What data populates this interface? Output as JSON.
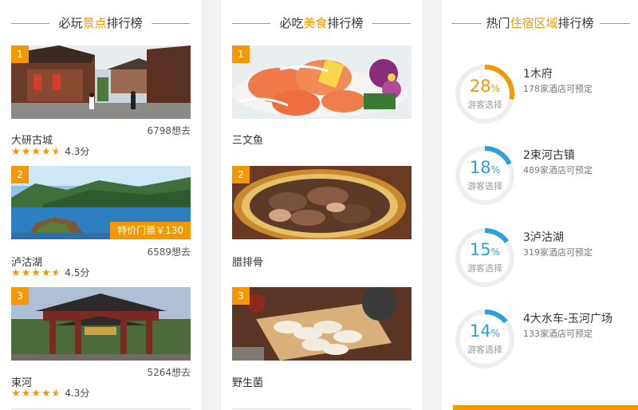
{
  "columns": {
    "sights": {
      "title_pre": "必玩",
      "title_hl": "景点",
      "title_post": "排行榜",
      "items": [
        {
          "rank": "1",
          "name": "大研古城",
          "want": "6798想去",
          "stars": "★★★★",
          "score": "4.3分"
        },
        {
          "rank": "2",
          "name": "泸沽湖",
          "want": "6589想去",
          "stars": "★★★★",
          "score": "4.5分",
          "price_tag": "特价门票￥130"
        },
        {
          "rank": "3",
          "name": "束河",
          "want": "5264想去",
          "stars": "★★★★",
          "score": "4.3分"
        }
      ]
    },
    "food": {
      "title_pre": "必吃",
      "title_hl": "美食",
      "title_post": "排行榜",
      "items": [
        {
          "rank": "1",
          "name": "三文鱼"
        },
        {
          "rank": "2",
          "name": "腊排骨"
        },
        {
          "rank": "3",
          "name": "野生菌"
        }
      ]
    },
    "areas": {
      "title_pre": "热门",
      "title_hl": "住宿区域",
      "title_post": "排行榜",
      "caption": "游客选择",
      "items": [
        {
          "percent": "28",
          "percent_value": 0.28,
          "name": "1木府",
          "count": "178家酒店可预定",
          "accent": "#f39800"
        },
        {
          "percent": "18",
          "percent_value": 0.18,
          "name": "2束河古镇",
          "count": "489家酒店可预定",
          "accent": "#2d9fe0"
        },
        {
          "percent": "15",
          "percent_value": 0.15,
          "name": "3泸沽湖",
          "count": "319家酒店可预定",
          "accent": "#2d9fe0"
        },
        {
          "percent": "14",
          "percent_value": 0.14,
          "name": "4大水车-玉河广场",
          "count": "133家酒店可预定",
          "accent": "#2d9fe0"
        }
      ]
    }
  },
  "colors": {
    "accent": "#f39800",
    "blue": "#2d9fe0"
  }
}
